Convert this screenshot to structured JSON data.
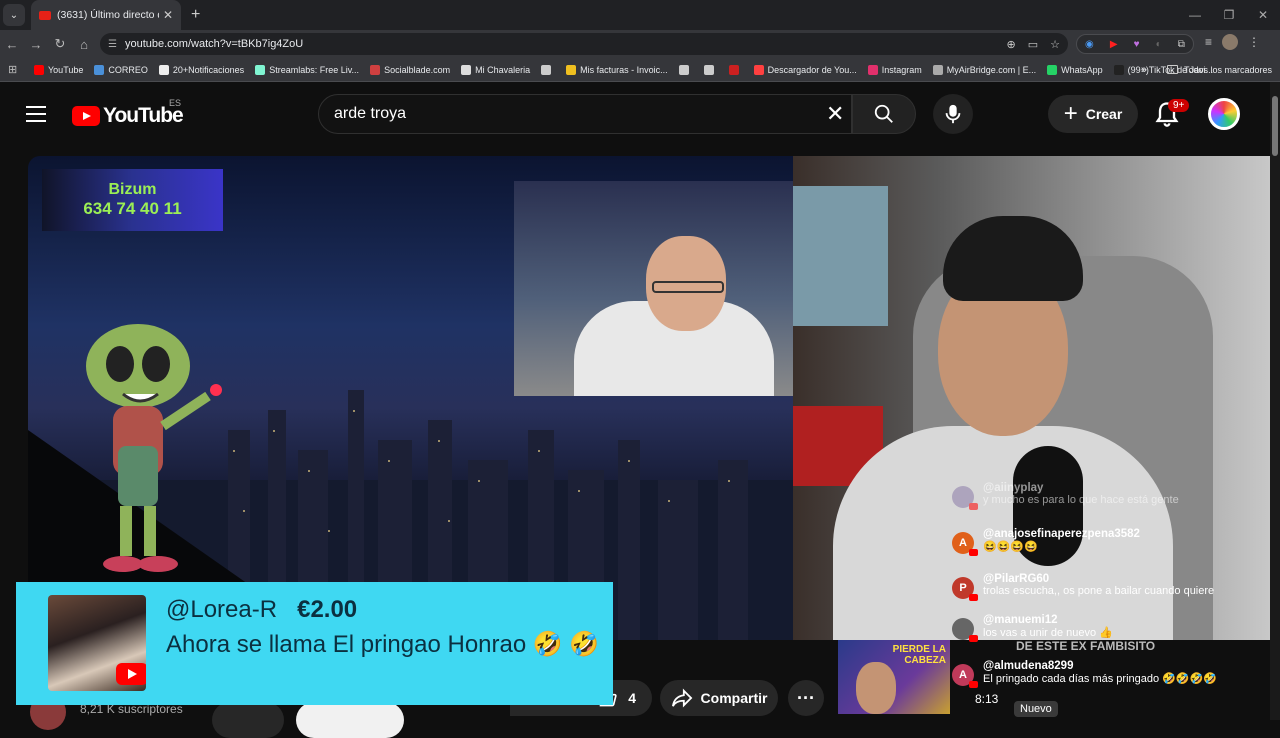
{
  "browser": {
    "tab_title": "(3631) Último directo del año -",
    "url": "youtube.com/watch?v=tBKb7ig4ZoU",
    "bookmarks": [
      {
        "label": "YouTube",
        "color": "#ff0000"
      },
      {
        "label": "CORREO",
        "color": "#4a90d9"
      },
      {
        "label": "20+Notificaciones",
        "color": "#eeeeee"
      },
      {
        "label": "Streamlabs: Free Liv...",
        "color": "#80f5d2"
      },
      {
        "label": "Socialblade.com",
        "color": "#d04040"
      },
      {
        "label": "Mi Chavaleria",
        "color": "#dddddd"
      },
      {
        "label": "",
        "color": "#cccccc"
      },
      {
        "label": "Mis facturas - Invoic...",
        "color": "#f0c020"
      },
      {
        "label": "",
        "color": "#cccccc"
      },
      {
        "label": "",
        "color": "#cccccc"
      },
      {
        "label": "",
        "color": "#cc2020"
      },
      {
        "label": "Descargador de You...",
        "color": "#ff4040"
      },
      {
        "label": "Instagram",
        "color": "#e1306c"
      },
      {
        "label": "MyAirBridge.com | E...",
        "color": "#aaaaaa"
      },
      {
        "label": "WhatsApp",
        "color": "#25d366"
      },
      {
        "label": "(99+)TikTok de Javi...",
        "color": "#222222"
      }
    ],
    "all_bookmarks": "Todos los marcadores",
    "more_bookmarks": "»"
  },
  "youtube": {
    "logo_text": "YouTube",
    "region": "ES",
    "search_value": "arde troya",
    "create_label": "Crear",
    "notif_badge": "9+"
  },
  "video": {
    "bizum_title": "Bizum",
    "bizum_number": "634 74 40 11"
  },
  "chat": [
    {
      "user": "@aiinyplay",
      "text": "y mucho es para lo que hace está gente",
      "initial": "",
      "color": "#8a7aa8",
      "faded": true
    },
    {
      "user": "@anajosefinaperezpena3582",
      "text": "😆😆😆😆",
      "initial": "A",
      "color": "#e0601a",
      "faded": false
    },
    {
      "user": "@PilarRG60",
      "text": "trolas escucha,, os pone a bailar cuando quiere",
      "initial": "P",
      "color": "#c0392b",
      "faded": false
    },
    {
      "user": "@manuemi12",
      "text": "los vas a unir de nuevo 👍",
      "initial": "",
      "color": "#666666",
      "faded": false
    },
    {
      "user": "@almudena8299",
      "text": "El pringado cada días más pringado 🤣🤣🤣🤣",
      "initial": "A",
      "color": "#c03a5a",
      "faded": false
    }
  ],
  "overlay": {
    "ticker": "DE ESTE EX FAMBISITO",
    "time": "8:13",
    "new_label": "Nuevo",
    "thumb_label_1": "PIERDE LA",
    "thumb_label_2": "CABEZA"
  },
  "superchat": {
    "user": "@Lorea-R",
    "amount": "€2.00",
    "message": "Ahora se llama El pringao Honrao 🤣 🤣"
  },
  "below_video": {
    "subscribers": "8,21 K suscriptores",
    "likes": "4",
    "share_label": "Compartir",
    "more_label": "···"
  }
}
